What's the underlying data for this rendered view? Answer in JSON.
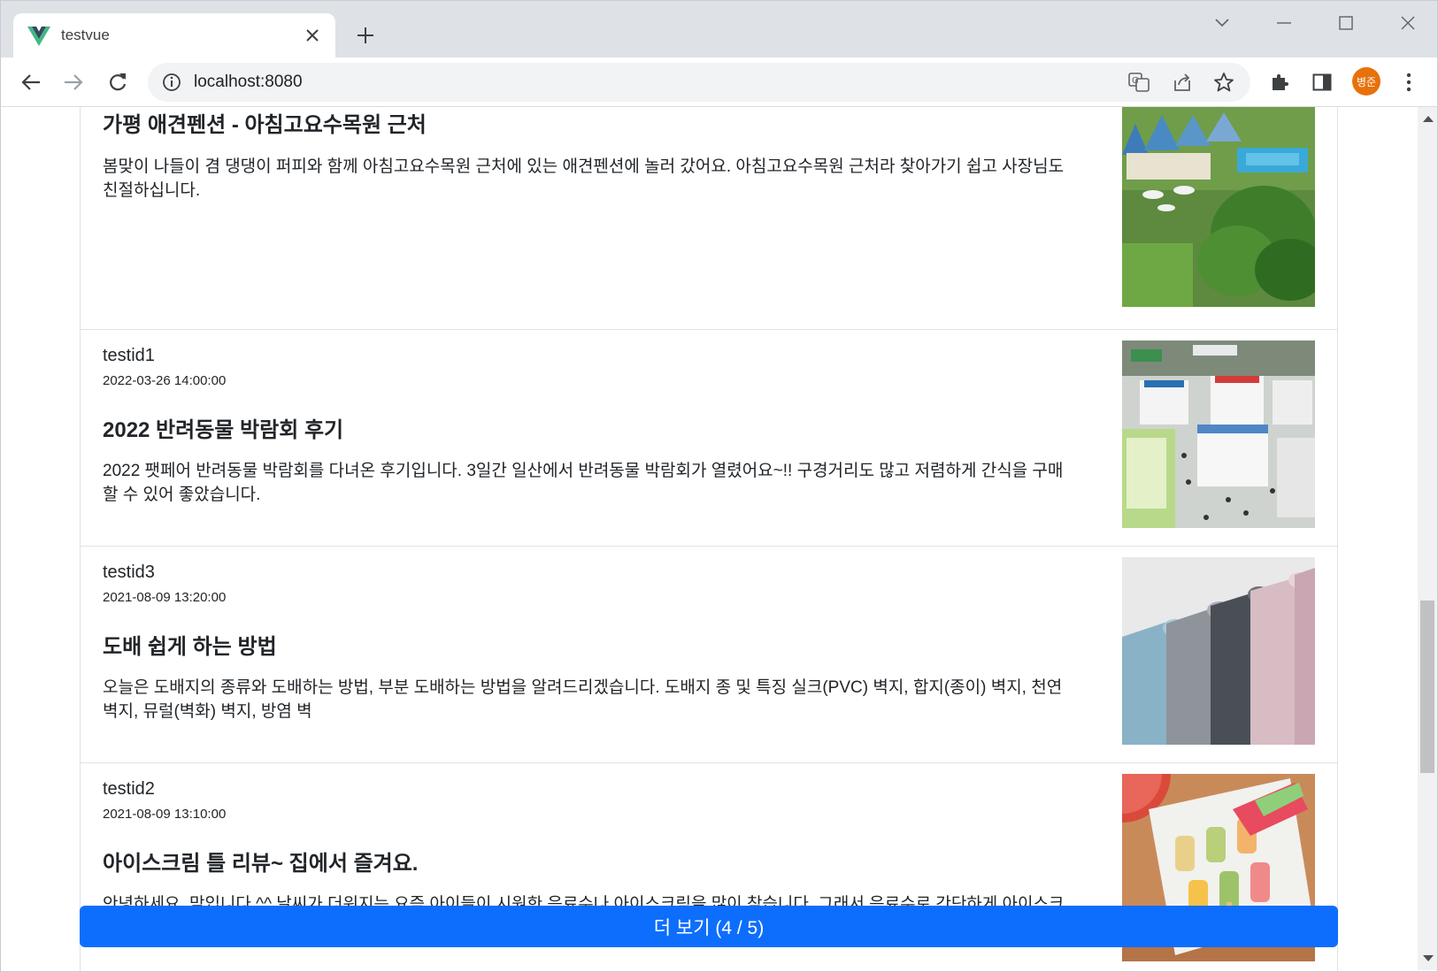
{
  "browser": {
    "tab_title": "testvue",
    "url": "localhost:8080",
    "profile_initials": "병준",
    "accent_color": "#0d6efd"
  },
  "posts": [
    {
      "author": "",
      "date": "",
      "title": "가평 애견펜션 - 아침고요수목원 근처",
      "excerpt": "봄맞이 나들이 겸 댕댕이 퍼피와 함께 아침고요수목원 근처에 있는 애견펜션에 놀러 갔어요. 아침고요수목원 근처라 찾아가기 쉽고 사장님도 친절하십니다.",
      "image": "pension-resort-photo"
    },
    {
      "author": "testid1",
      "date": "2022-03-26 14:00:00",
      "title": "2022 반려동물 박람회 후기",
      "excerpt": "2022 팻페어 반려동물 박람회를 다녀온 후기입니다. 3일간 일산에서 반려동물 박람회가 열렸어요~!! 구경거리도 많고 저렴하게 간식을 구매할 수 있어 좋았습니다.",
      "image": "pet-expo-hall-photo"
    },
    {
      "author": "testid3",
      "date": "2021-08-09 13:20:00",
      "title": "도배 쉽게 하는 방법",
      "excerpt": "오늘은 도배지의 종류와 도배하는 방법, 부분 도배하는 방법을 알려드리겠습니다. 도배지 종 및 특징 실크(PVC) 벽지, 합지(종이) 벽지, 천연 벽지, 뮤럴(벽화) 벽지, 방염 벽",
      "image": "wallpaper-rolls-photo"
    },
    {
      "author": "testid2",
      "date": "2021-08-09 13:10:00",
      "title": "아이스크림 틀 리뷰~ 집에서 즐겨요.",
      "excerpt": "안녕하세요. 맘입니다.^^ 날씨가 더워지는 요즘 아이들이 시원한 음료수나 아이스크림을 많이 찾습니다. 그래서 음료수로 간단하게 아이스크림을 만들 수 있는 틀을 리뷰하려고 합니다.",
      "image": "popsicle-mold-photo"
    }
  ],
  "more_button_label": "더 보기 (4 / 5)"
}
